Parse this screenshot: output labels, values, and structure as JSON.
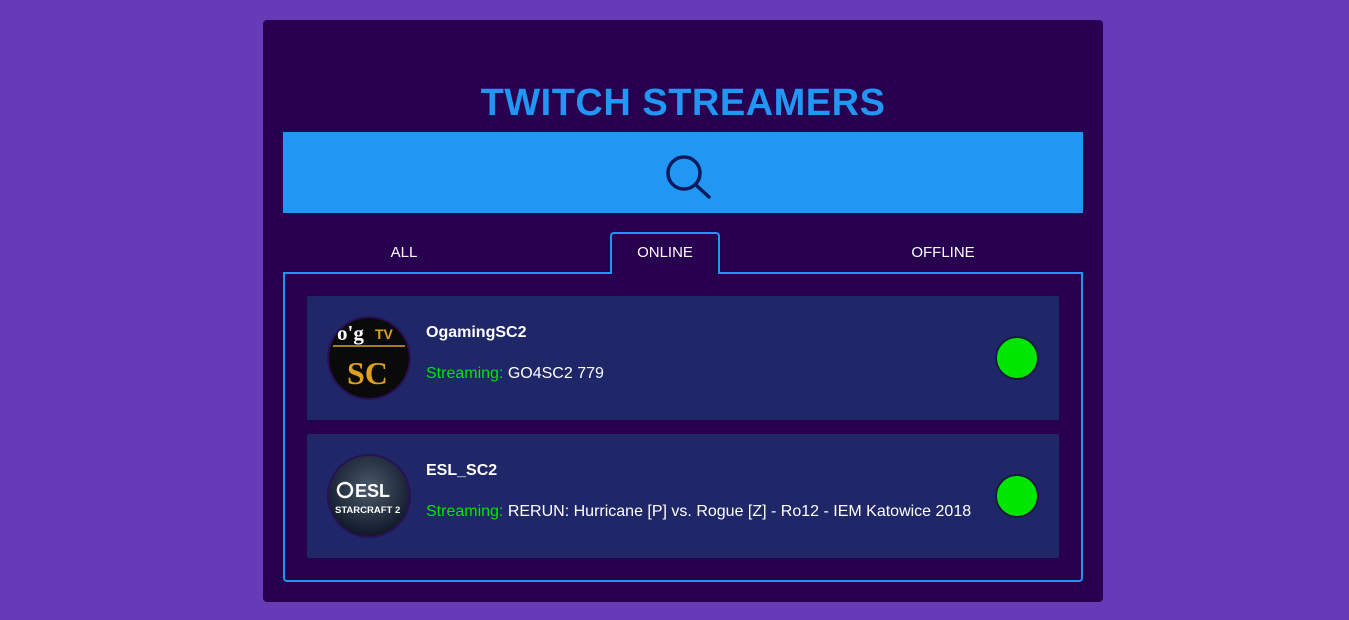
{
  "app": {
    "title": "TWITCH STREAMERS"
  },
  "search": {
    "icon": "search-icon"
  },
  "tabs": [
    {
      "label": "ALL",
      "active": false
    },
    {
      "label": "ONLINE",
      "active": true
    },
    {
      "label": "OFFLINE",
      "active": false
    }
  ],
  "streamers": [
    {
      "name": "OgamingSC2",
      "status_label": "Streaming:",
      "stream_title": "GO4SC2 779",
      "online": true
    },
    {
      "name": "ESL_SC2",
      "status_label": "Streaming:",
      "stream_title": "RERUN: Hurricane [P] vs. Rogue [Z] - Ro12 - IEM Katowice 2018",
      "online": true
    }
  ],
  "logos": {
    "ogaming": {
      "line1": "o'g",
      "line2": "TV",
      "line3": "SC"
    },
    "esl": {
      "line1": "ESL",
      "line2": "STARCRAFT 2"
    }
  },
  "colors": {
    "background": "#673ab7",
    "panel": "#27004f",
    "accent": "#2196f3",
    "card": "#1f2768",
    "online": "#00e600"
  }
}
